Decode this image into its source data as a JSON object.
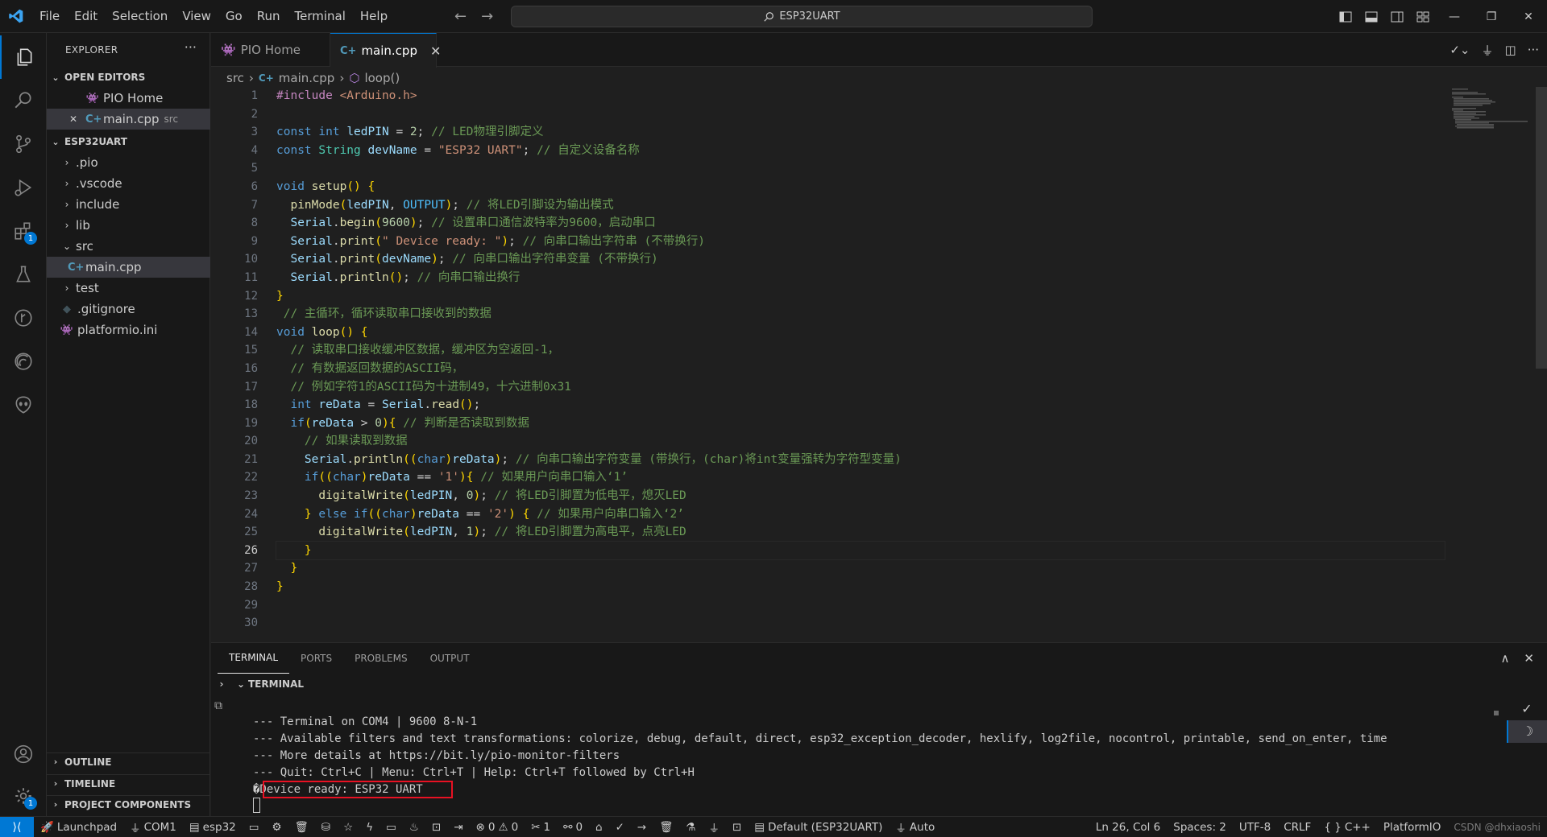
{
  "menu": [
    "File",
    "Edit",
    "Selection",
    "View",
    "Go",
    "Run",
    "Terminal",
    "Help"
  ],
  "search": {
    "text": "ESP32UART"
  },
  "explorer": {
    "title": "EXPLORER",
    "open_editors_label": "OPEN EDITORS",
    "open_editors": [
      {
        "name": "PIO Home",
        "desc": ""
      },
      {
        "name": "main.cpp",
        "desc": "src"
      }
    ],
    "project_label": "ESP32UART",
    "tree": [
      ".pio",
      ".vscode",
      "include",
      "lib",
      "src",
      "main.cpp",
      "test",
      ".gitignore",
      "platformio.ini"
    ],
    "outline_label": "OUTLINE",
    "timeline_label": "TIMELINE",
    "project_components_label": "PROJECT COMPONENTS"
  },
  "tabs": [
    {
      "label": "PIO Home"
    },
    {
      "label": "main.cpp"
    }
  ],
  "breadcrumb": {
    "folder": "src",
    "file": "main.cpp",
    "symbol": "loop()"
  },
  "editor": {
    "current_line": 26,
    "lines": [
      "#include <Arduino.h>",
      "",
      "const int ledPIN = 2; // LED物理引脚定义",
      "const String devName = \"ESP32 UART\"; // 自定义设备名称",
      "",
      "void setup() {",
      "  pinMode(ledPIN, OUTPUT); // 将LED引脚设为输出模式",
      "  Serial.begin(9600); // 设置串口通信波特率为9600，启动串口",
      "  Serial.print(\" Device ready: \"); // 向串口输出字符串 (不带换行)",
      "  Serial.print(devName); // 向串口输出字符串变量 (不带换行)",
      "  Serial.println(); // 向串口输出换行",
      "}",
      " // 主循环，循环读取串口接收到的数据",
      "void loop() {",
      "  // 读取串口接收缓冲区数据，缓冲区为空返回-1，",
      "  // 有数据返回数据的ASCII码，",
      "  // 例如字符1的ASCII码为十进制49，十六进制0x31",
      "  int reData = Serial.read();",
      "  if(reData > 0){ // 判断是否读取到数据",
      "    // 如果读取到数据",
      "    Serial.println((char)reData); // 向串口输出字符变量 (带换行，(char)将int变量强转为字符型变量)",
      "    if((char)reData == '1'){ // 如果用户向串口输入‘1’",
      "      digitalWrite(ledPIN, 0); // 将LED引脚置为低电平，熄灭LED",
      "    } else if((char)reData == '2') { // 如果用户向串口输入‘2’",
      "      digitalWrite(ledPIN, 1); // 将LED引脚置为高电平，点亮LED",
      "    }",
      "  }",
      "}",
      "",
      ""
    ]
  },
  "panel": {
    "tabs": [
      "TERMINAL",
      "PORTS",
      "PROBLEMS",
      "OUTPUT"
    ],
    "terminal_header": "TERMINAL",
    "output": [
      "--- Terminal on COM4 | 9600 8-N-1",
      "--- Available filters and text transformations: colorize, debug, default, direct, esp32_exception_decoder, hexlify, log2file, nocontrol, printable, send_on_enter, time",
      "--- More details at https://bit.ly/pio-monitor-filters",
      "--- Quit: Ctrl+C | Menu: Ctrl+T | Help: Ctrl+T followed by Ctrl+H",
      "�Device ready: ESP32 UART"
    ]
  },
  "statusbar": {
    "launchpad": "Launchpad",
    "port": "COM1",
    "env": "esp32",
    "errors": "0",
    "warnings": "0",
    "sync": "1",
    "ports_count": "0",
    "default_env": "Default (ESP32UART)",
    "auto": "Auto",
    "position": "Ln 26, Col 6",
    "spaces": "Spaces: 2",
    "encoding": "UTF-8",
    "eol": "CRLF",
    "language": "C++",
    "platform": "PlatformIO",
    "watermark": "CSDN @dhxiaoshi"
  },
  "colors": {
    "accent": "#0078d4",
    "highlight_box": "#e81123",
    "badge": "#0078d4"
  },
  "badges": {
    "extensions": "1",
    "settings": "1"
  }
}
